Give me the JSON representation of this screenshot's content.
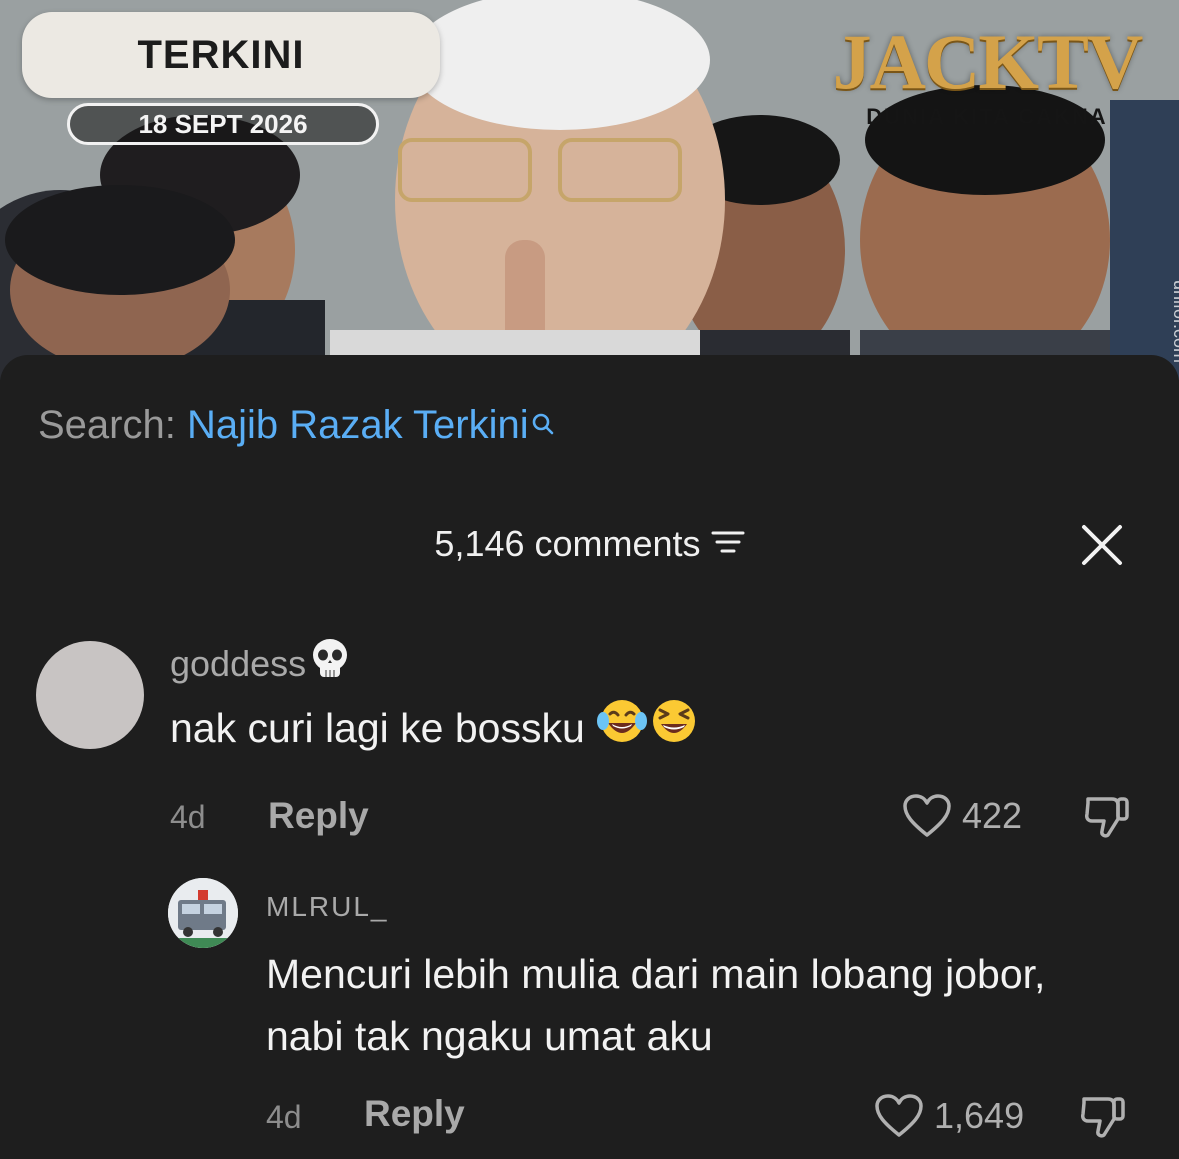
{
  "video": {
    "badge_label": "TERKINI",
    "date_label": "18 SEPT 2026",
    "brand_name": "JACKTV",
    "brand_tagline": "DUNIA KITA CAKNA",
    "watermark": "unifor.com"
  },
  "search": {
    "prefix": "Search: ",
    "query": "Najib Razak Terkini"
  },
  "comments_header": {
    "count_label": "5,146 comments"
  },
  "comments": [
    {
      "username": "goddess",
      "text": "nak curi lagi ke bossku",
      "time": "4d",
      "reply_label": "Reply",
      "likes": "422"
    }
  ],
  "replies": [
    {
      "username": "MLRUL_",
      "text": "Mencuri lebih mulia dari main lobang jobor, nabi tak ngaku umat aku",
      "time": "4d",
      "reply_label": "Reply",
      "likes": "1,649"
    }
  ],
  "colors": {
    "background": "#1e1e1e",
    "link_blue": "#5aaef5",
    "brand_gold": "#d4a24a"
  },
  "icons": [
    "search-icon",
    "filter-icon",
    "close-icon",
    "skull-icon",
    "heart-icon",
    "dislike-icon",
    "laughing-tears-icon",
    "grinning-squint-icon"
  ]
}
